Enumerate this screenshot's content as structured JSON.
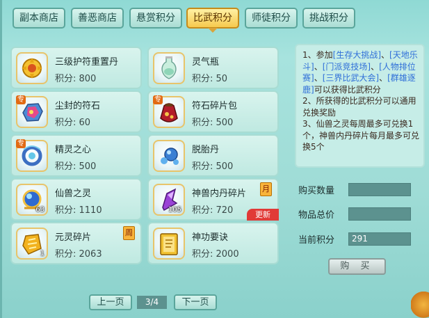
{
  "tabs": [
    {
      "label": "副本商店",
      "active": false
    },
    {
      "label": "善恶商店",
      "active": false
    },
    {
      "label": "悬赏积分",
      "active": false
    },
    {
      "label": "比武积分",
      "active": true
    },
    {
      "label": "师徒积分",
      "active": false
    },
    {
      "label": "挑战积分",
      "active": false
    }
  ],
  "items": [
    {
      "name": "三级护符重置丹",
      "points": "积分: 800",
      "icon": "golden-charm-pill-icon",
      "count": "",
      "zhuan": "",
      "side_badge": "",
      "ribbon": ""
    },
    {
      "name": "灵气瓶",
      "points": "积分: 50",
      "icon": "spirit-vase-icon",
      "count": "",
      "zhuan": "",
      "side_badge": "",
      "ribbon": ""
    },
    {
      "name": "尘封的符石",
      "points": "积分: 60",
      "icon": "rune-stone-icon",
      "count": "",
      "zhuan": "专",
      "side_badge": "",
      "ribbon": ""
    },
    {
      "name": "符石碎片包",
      "points": "积分: 500",
      "icon": "rune-fragment-bag-icon",
      "count": "",
      "zhuan": "专",
      "side_badge": "",
      "ribbon": ""
    },
    {
      "name": "精灵之心",
      "points": "积分: 500",
      "icon": "spirit-heart-icon",
      "count": "",
      "zhuan": "专",
      "side_badge": "",
      "ribbon": ""
    },
    {
      "name": "脱胎丹",
      "points": "积分: 500",
      "icon": "rebirth-pill-icon",
      "count": "",
      "zhuan": "",
      "side_badge": "",
      "ribbon": ""
    },
    {
      "name": "仙兽之灵",
      "points": "积分: 1110",
      "icon": "beast-spirit-orb-icon",
      "count": "63",
      "zhuan": "",
      "side_badge": "",
      "ribbon": ""
    },
    {
      "name": "神兽内丹碎片",
      "points": "积分: 720",
      "icon": "beast-core-shard-icon",
      "count": "105",
      "zhuan": "",
      "side_badge": "月",
      "ribbon": "更新"
    },
    {
      "name": "元灵碎片",
      "points": "积分: 2063",
      "icon": "soul-shard-icon",
      "count": "1",
      "zhuan": "",
      "side_badge": "周",
      "ribbon": ""
    },
    {
      "name": "神功要诀",
      "points": "积分: 2000",
      "icon": "skill-book-icon",
      "count": "",
      "zhuan": "",
      "side_badge": "",
      "ribbon": ""
    }
  ],
  "info": {
    "p1": "1、参加",
    "l1": "[生存大挑战]",
    "s1": "、",
    "l2": "[天地乐斗]",
    "s2": "、",
    "l3": "[门派竞技场]",
    "s3": "、",
    "l4": "[人物排位赛]",
    "s4": "、",
    "l5": "[三界比武大会]",
    "s5": "、",
    "l6": "[群雄逐鹿]",
    "p1_end": "可以获得比武积分",
    "p2": "2、所获得的比武积分可以通用兑换奖励",
    "p3": "3、仙兽之灵每周最多可兑换1个，神兽内丹碎片每月最多可兑换5个"
  },
  "purchase": {
    "qty_label": "购买数量",
    "qty_value": "",
    "total_label": "物品总价",
    "total_value": "",
    "current_label": "当前积分",
    "current_value": "291",
    "buy_label": "购 买"
  },
  "pager": {
    "prev": "上一页",
    "page": "3/4",
    "next": "下一页"
  }
}
